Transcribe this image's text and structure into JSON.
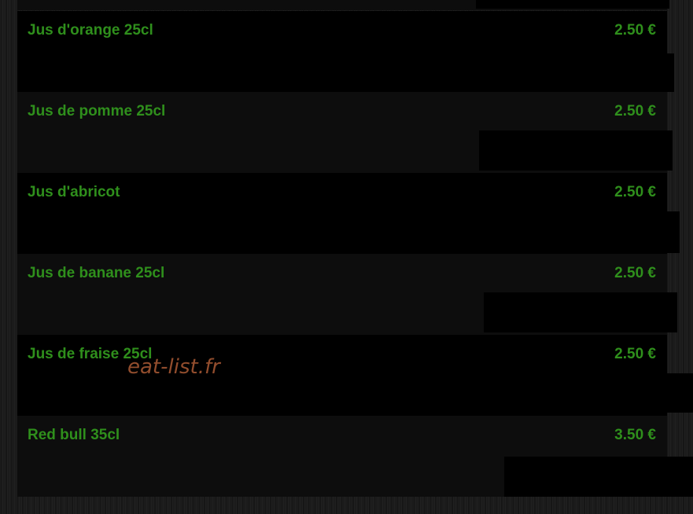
{
  "menu": {
    "items": [
      {
        "name": "Jus d'orange 25cl",
        "price": "2.50 €"
      },
      {
        "name": "Jus de pomme 25cl",
        "price": "2.50 €"
      },
      {
        "name": "Jus d'abricot",
        "price": "2.50 €"
      },
      {
        "name": "Jus de banane 25cl",
        "price": "2.50 €"
      },
      {
        "name": "Jus de fraise 25cl",
        "price": "2.50 €"
      },
      {
        "name": "Red bull 35cl",
        "price": "3.50 €"
      }
    ]
  },
  "watermark": {
    "text": "eat-list.fr"
  },
  "colors": {
    "item_text": "#2f8f1c",
    "watermark": "#9a5230",
    "row_dark": "#000000",
    "row_light": "#0d0d0d",
    "background": "#1b1b1b"
  }
}
